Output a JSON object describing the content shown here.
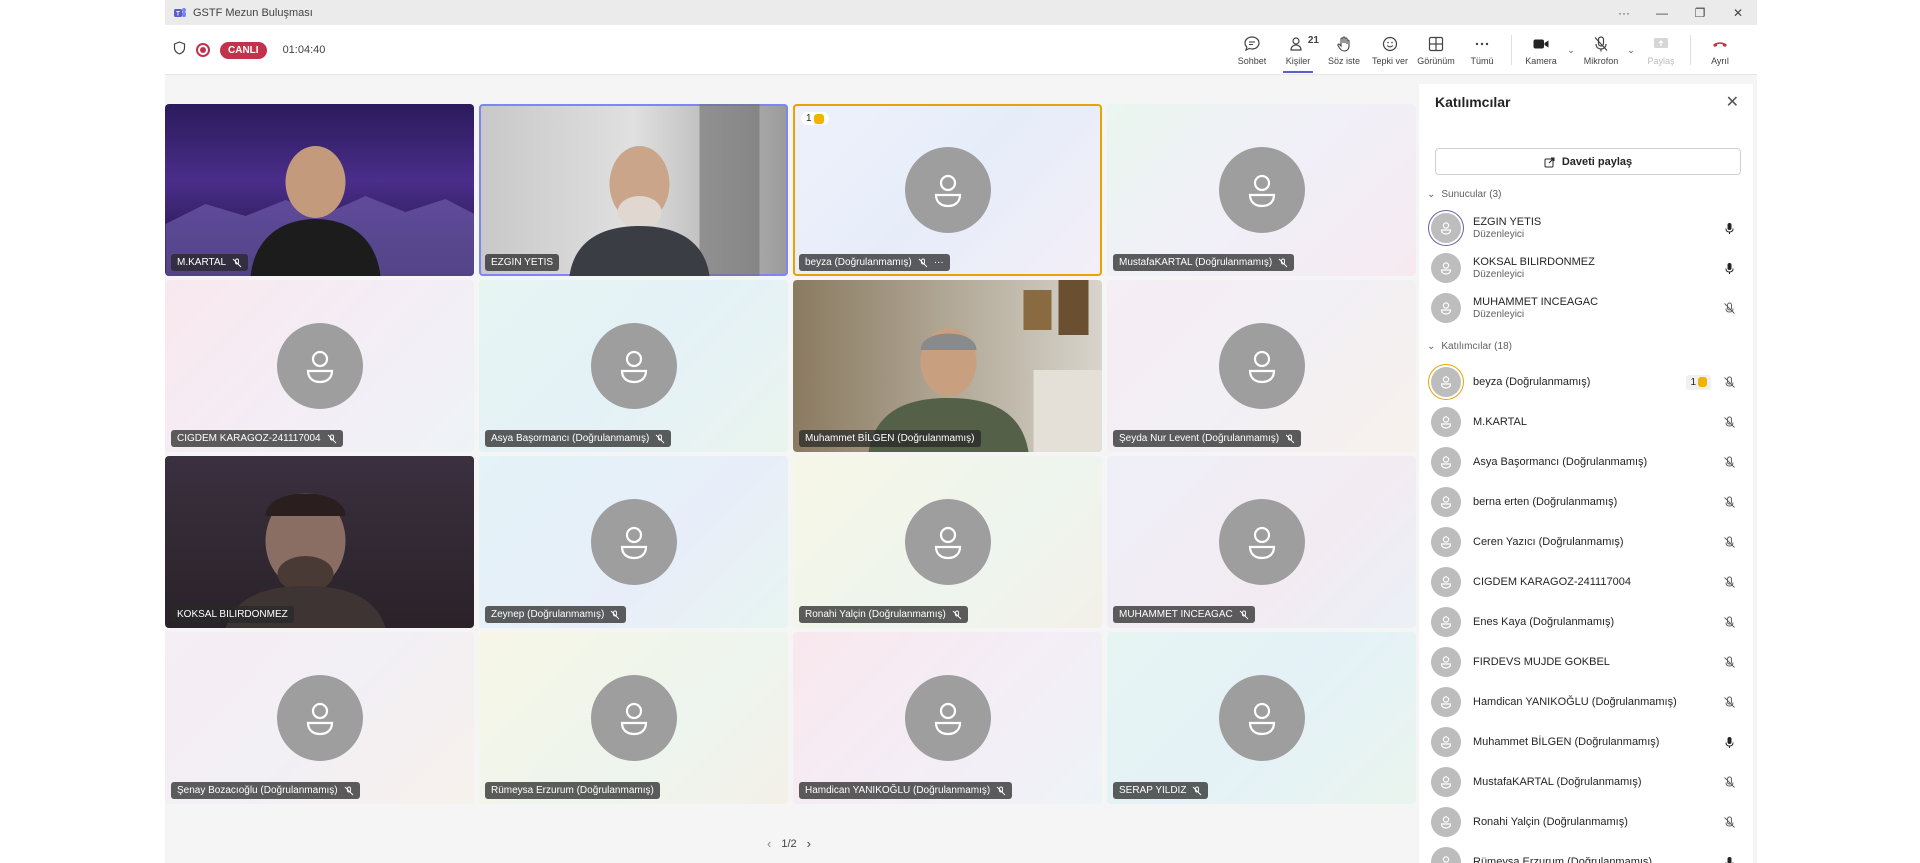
{
  "window": {
    "title": "GSTF Mezun Buluşması"
  },
  "meeting": {
    "live_label": "CANLI",
    "elapsed": "01:04:40"
  },
  "toolbar": {
    "chat": "Sohbet",
    "people": "Kişiler",
    "people_count": "21",
    "raise_hand": "Söz iste",
    "react": "Tepki ver",
    "view": "Görünüm",
    "more": "Tümü",
    "camera": "Kamera",
    "mic": "Mikrofon",
    "share": "Paylaş",
    "leave": "Ayrıl"
  },
  "tiles": [
    {
      "name": "M.KARTAL"
    },
    {
      "name": "EZGIN YETIS"
    },
    {
      "name": "beyza (Doğrulanmamış)",
      "hand_count": "1"
    },
    {
      "name": "MustafaKARTAL (Doğrulanmamış)"
    },
    {
      "name": "CIGDEM KARAGOZ-241117004"
    },
    {
      "name": "Asya Başormancı (Doğrulanmamış)"
    },
    {
      "name": "Muhammet BİLGEN (Doğrulanmamış)"
    },
    {
      "name": "Şeyda Nur Levent (Doğrulanmamış)"
    },
    {
      "name": "KOKSAL BILIRDONMEZ"
    },
    {
      "name": "Zeynep (Doğrulanmamış)"
    },
    {
      "name": "Ronahi Yalçin (Doğrulanmamış)"
    },
    {
      "name": "MUHAMMET INCEAGAC"
    },
    {
      "name": "Şenay Bozacıoğlu (Doğrulanmamış)"
    },
    {
      "name": "Rümeysa Erzurum (Doğrulanmamış)"
    },
    {
      "name": "Hamdican YANIKOĞLU (Doğrulanmamış)"
    },
    {
      "name": "SERAP YILDIZ"
    }
  ],
  "pager": {
    "label": "1/2"
  },
  "panel": {
    "title": "Katılımcılar",
    "share_invite": "Daveti paylaş",
    "presenters_header": "Sunucular (3)",
    "presenters": [
      {
        "name": "EZGIN YETIS",
        "role": "Düzenleyici",
        "mic": "on"
      },
      {
        "name": "KOKSAL BILIRDONMEZ",
        "role": "Düzenleyici",
        "mic": "on"
      },
      {
        "name": "MUHAMMET INCEAGAC",
        "role": "Düzenleyici",
        "mic": "off"
      }
    ],
    "attendees_header": "Katılımcılar (18)",
    "attendees": [
      {
        "name": "beyza (Doğrulanmamış)",
        "hand_count": "1",
        "mic": "off"
      },
      {
        "name": "M.KARTAL",
        "mic": "off"
      },
      {
        "name": "Asya Başormancı (Doğrulanmamış)",
        "mic": "off"
      },
      {
        "name": "berna erten (Doğrulanmamış)",
        "mic": "off"
      },
      {
        "name": "Ceren Yazıcı (Doğrulanmamış)",
        "mic": "off"
      },
      {
        "name": "CIGDEM KARAGOZ-241117004",
        "mic": "off"
      },
      {
        "name": "Enes Kaya (Doğrulanmamış)",
        "mic": "off"
      },
      {
        "name": "FIRDEVS MUJDE GOKBEL",
        "mic": "off"
      },
      {
        "name": "Hamdican YANIKOĞLU (Doğrulanmamış)",
        "mic": "off"
      },
      {
        "name": "Muhammet BİLGEN (Doğrulanmamış)",
        "mic": "on"
      },
      {
        "name": "MustafaKARTAL (Doğrulanmamış)",
        "mic": "off"
      },
      {
        "name": "Ronahi Yalçin (Doğrulanmamış)",
        "mic": "off"
      },
      {
        "name": "Rümeysa Erzurum (Doğrulanmamış)",
        "mic": "on"
      }
    ]
  },
  "colors": {
    "accent": "#5b5fc7",
    "live": "#c4314b",
    "leave": "#c4314b",
    "hand": "#e8a300"
  }
}
